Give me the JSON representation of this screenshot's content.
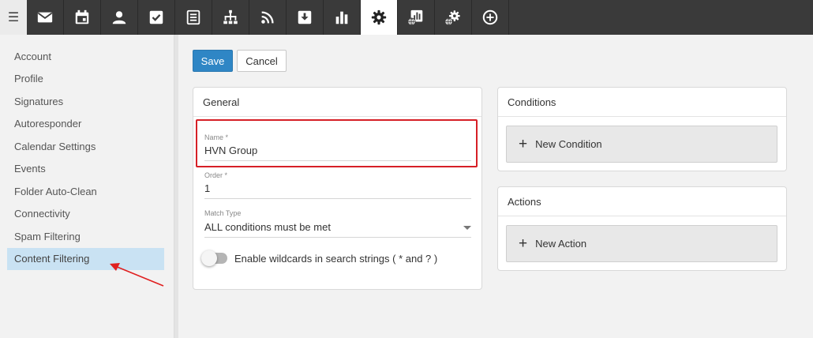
{
  "toolbar": {
    "menu_icon": "hamburger-icon",
    "items": [
      {
        "icon": "mail-icon"
      },
      {
        "icon": "calendar-icon"
      },
      {
        "icon": "contacts-icon"
      },
      {
        "icon": "tasks-icon"
      },
      {
        "icon": "notes-icon"
      },
      {
        "icon": "sitemap-icon"
      },
      {
        "icon": "rss-icon"
      },
      {
        "icon": "file-storage-icon"
      },
      {
        "icon": "reports-icon"
      },
      {
        "icon": "settings-icon",
        "active": true
      },
      {
        "icon": "domain-reports-icon"
      },
      {
        "icon": "domain-settings-icon"
      },
      {
        "icon": "add-circle-icon"
      }
    ]
  },
  "sidebar": {
    "items": [
      {
        "label": "Account"
      },
      {
        "label": "Profile"
      },
      {
        "label": "Signatures"
      },
      {
        "label": "Autoresponder"
      },
      {
        "label": "Calendar Settings"
      },
      {
        "label": "Events"
      },
      {
        "label": "Folder Auto-Clean"
      },
      {
        "label": "Connectivity"
      },
      {
        "label": "Spam Filtering"
      },
      {
        "label": "Content Filtering",
        "active": true
      }
    ]
  },
  "actions": {
    "save_label": "Save",
    "cancel_label": "Cancel"
  },
  "general": {
    "title": "General",
    "name_label": "Name *",
    "name_value": "HVN Group",
    "order_label": "Order *",
    "order_value": "1",
    "match_label": "Match Type",
    "match_value": "ALL conditions must be met",
    "wildcard_label": "Enable wildcards in search strings ( * and ? )",
    "wildcard_enabled": false
  },
  "conditions": {
    "title": "Conditions",
    "new_label": "New Condition"
  },
  "actions_card": {
    "title": "Actions",
    "new_label": "New Action"
  },
  "colors": {
    "primary": "#2f86c5",
    "highlight": "#d61f26",
    "active_nav": "#c9e2f3",
    "toolbar": "#3a3a3a"
  }
}
